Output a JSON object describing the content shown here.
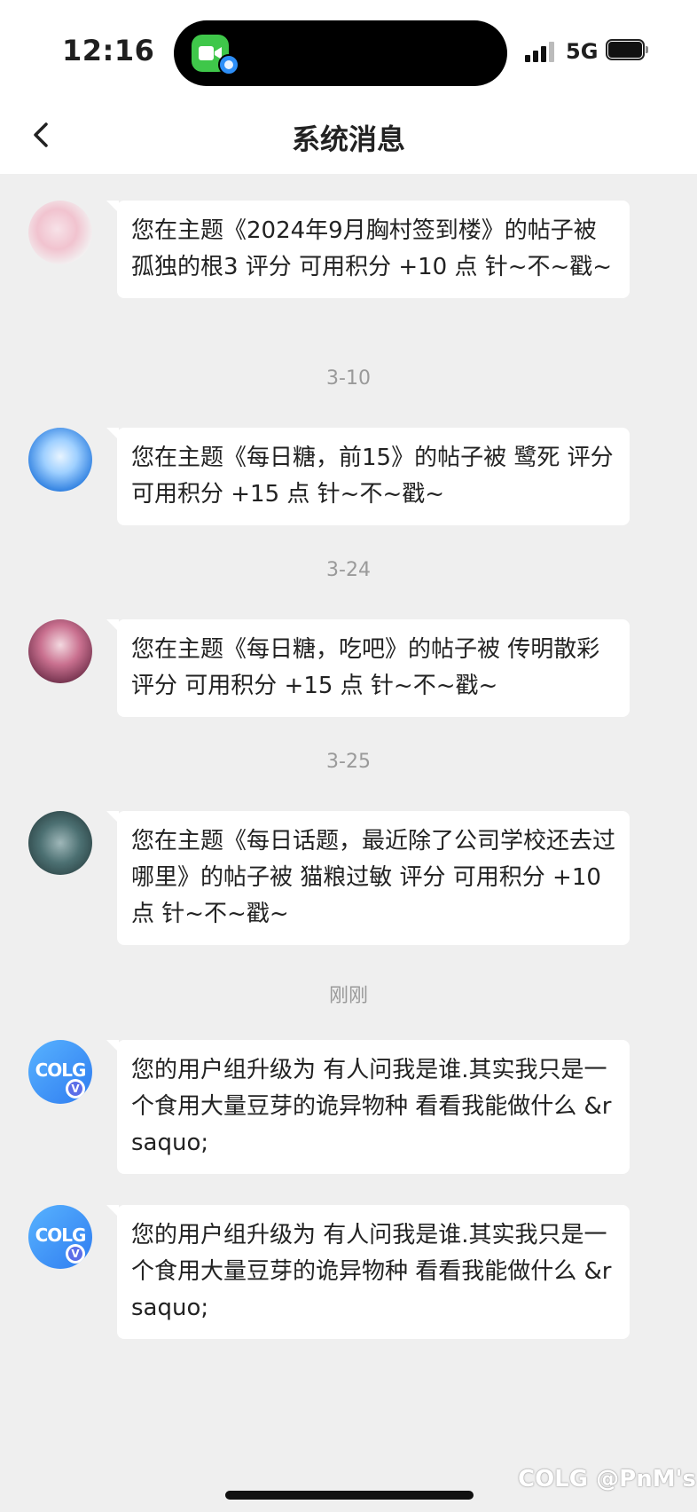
{
  "status_bar": {
    "time": "12:16",
    "network": "5G"
  },
  "nav": {
    "title": "系统消息"
  },
  "messages": [
    {
      "avatar": "anime-girls-avatar",
      "text": "您在主题《2024年9月胸村签到楼》的帖子被 孤独的根3 评分 可用积分 +10 点 针~不~戳~"
    },
    {
      "avatar": "sky-clouds-avatar",
      "text": "您在主题《每日糖，前15》的帖子被 鹭死 评分 可用积分 +15 点 针~不~戳~"
    },
    {
      "avatar": "pink-hair-girl-avatar",
      "text": "您在主题《每日糖，吃吧》的帖子被 传明散彩 评分 可用积分 +15 点 针~不~戳~"
    },
    {
      "avatar": "owl-avatar",
      "text": "您在主题《每日话题，最近除了公司学校还去过哪里》的帖子被 猫粮过敏 评分 可用积分 +10 点 针~不~戳~"
    },
    {
      "avatar": "colg-logo-avatar",
      "logo": "COLG",
      "badge": "V",
      "text": "您的用户组升级为  有人问我是谁.其实我只是一个食用大量豆芽的诡异物种   看看我能做什么 &rsaquo;"
    },
    {
      "avatar": "colg-logo-avatar",
      "logo": "COLG",
      "badge": "V",
      "text": "您的用户组升级为  有人问我是谁.其实我只是一个食用大量豆芽的诡异物种   看看我能做什么 &rsaquo;"
    }
  ],
  "dividers": [
    "3-10",
    "3-24",
    "3-25",
    "刚刚"
  ],
  "watermark": "COLG @PnM's"
}
